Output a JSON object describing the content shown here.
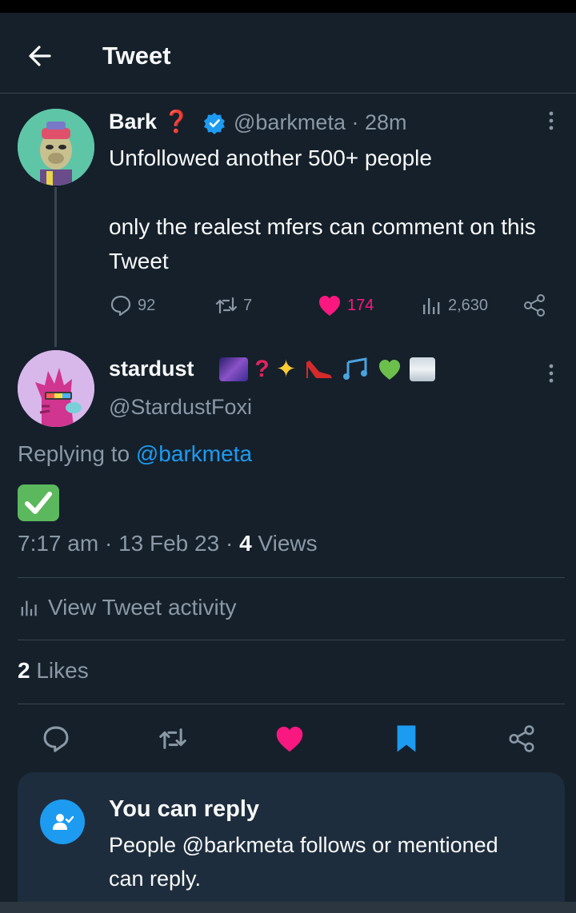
{
  "header": {
    "title": "Tweet",
    "back_icon": "arrow-left-icon"
  },
  "parent_tweet": {
    "display_name": "Bark",
    "name_emoji": "❓",
    "verified_icon": "verified-badge-icon",
    "handle": "@barkmeta",
    "separator": "·",
    "time": "28m",
    "text_line1": "Unfollowed another 500+ people",
    "text_line2": "only the realest mfers can comment on this Tweet",
    "replies": "92",
    "retweets": "7",
    "likes": "174",
    "views": "2,630"
  },
  "reply_tweet": {
    "display_name": "stardust",
    "name_emojis": "🌌❓✨👠🎶💚🌫️",
    "handle": "@StardustFoxi",
    "replying_prefix": "Replying to",
    "replying_handle": "@barkmeta",
    "body_emoji": "✅",
    "time": "7:17 am",
    "date": "13 Feb 23",
    "views_count": "4",
    "views_label": "Views",
    "activity_label": "View Tweet activity",
    "likes_count": "2",
    "likes_label": "Likes"
  },
  "reply_card": {
    "title": "You can reply",
    "body": "People @barkmeta follows or mentioned can reply.",
    "icon": "person-check-icon"
  },
  "colors": {
    "background": "#15202b",
    "accent": "#1d9bf0",
    "like": "#f91880",
    "muted": "#8b98a5"
  }
}
